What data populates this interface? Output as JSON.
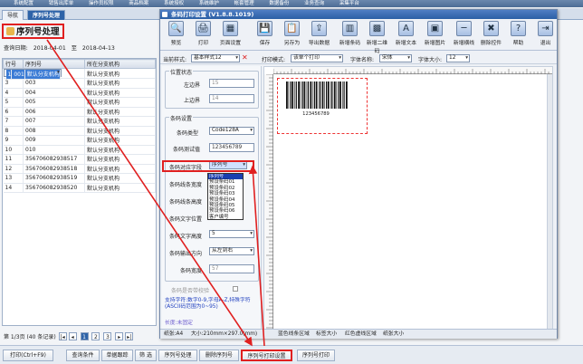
{
  "topbar": {
    "items": [
      "系统配置",
      "销售出库单",
      "操作员权限",
      "商品档案",
      "系统授权",
      "系统维护",
      "帐套管理",
      "数据备份",
      "业务查询",
      "采集平台"
    ]
  },
  "tabs": [
    {
      "label": "导航"
    },
    {
      "label": "序列号处理"
    }
  ],
  "page": {
    "title": "序列号处理"
  },
  "query": {
    "label": "查询日期:",
    "from": "2018-04-01",
    "to_label": "至",
    "to": "2018-04-13"
  },
  "grid": {
    "columns": [
      "行号",
      "序列号",
      "所在分支机构"
    ],
    "rows": [
      [
        "1",
        "001",
        "默认分支机构"
      ],
      [
        "2",
        "002",
        "默认分支机构"
      ],
      [
        "3",
        "003",
        "默认分支机构"
      ],
      [
        "4",
        "004",
        "默认分支机构"
      ],
      [
        "5",
        "005",
        "默认分支机构"
      ],
      [
        "6",
        "006",
        "默认分支机构"
      ],
      [
        "7",
        "007",
        "默认分支机构"
      ],
      [
        "8",
        "008",
        "默认分支机构"
      ],
      [
        "9",
        "009",
        "默认分支机构"
      ],
      [
        "10",
        "010",
        "默认分支机构"
      ],
      [
        "11",
        "356706082938517",
        "默认分支机构"
      ],
      [
        "12",
        "356706082938518",
        "默认分支机构"
      ],
      [
        "13",
        "356706082938519",
        "默认分支机构"
      ],
      [
        "14",
        "356706082938520",
        "默认分支机构"
      ]
    ]
  },
  "pager": {
    "summary": "第 1/3页 (40 条记录)",
    "pages": [
      "1",
      "2",
      "3"
    ]
  },
  "bottom_buttons": [
    "打印(Ctrl+F9)",
    "查询条件",
    "单据跟踪",
    "筛 选",
    "序列号处理",
    "删除序列号",
    "序列号打印设置",
    "序列号打印"
  ],
  "dialog": {
    "title": "条码打印设置 (V1.8.8.1019)",
    "toolbar": [
      "预览",
      "打印",
      "页面设置",
      "保存",
      "另存为",
      "导出数据",
      "新增条码",
      "新增二维码",
      "新增文本",
      "新增图片",
      "新增横线",
      "删除控件",
      "帮助",
      "退出"
    ],
    "toolbar_icons": [
      "preview-icon",
      "print-icon",
      "page-setup-icon",
      "save-icon",
      "save-as-icon",
      "export-icon",
      "barcode-icon",
      "qrcode-icon",
      "text-icon",
      "image-icon",
      "line-icon",
      "delete-icon",
      "help-icon",
      "exit-icon"
    ],
    "row2": {
      "template_label": "当前样式:",
      "template_value": "基本样式12",
      "print_mode_label": "打印模式:",
      "print_mode_value": "该单个打印",
      "font_label": "字体名称:",
      "font_value": "宋体",
      "size_label": "字体大小:",
      "size_value": "12"
    },
    "position": {
      "group": "位置状态",
      "left_label": "左边界",
      "left_value": "15",
      "top_label": "上边界",
      "top_value": "14"
    },
    "barcode": {
      "group": "条码设置",
      "type_label": "条码类型",
      "type_value": "Code128A",
      "test_label": "条码测试值",
      "test_value": "123456789",
      "field_label": "条码对应字段",
      "field_value": "序列号",
      "dropdown_options": [
        "序列号",
        "预设条码01",
        "预设条码02",
        "预设条码03",
        "预设条码04",
        "预设条码05",
        "预设条码06",
        "客户编号"
      ],
      "line_w_label": "条码线条宽度",
      "line_w_value": "",
      "line_h_label": "条码线条高度",
      "line_h_value": "",
      "font_pos_label": "条码文字位置",
      "font_pos_value": "",
      "text_size_label": "条码文字高度",
      "text_size_value": "5",
      "dir_label": "条码输出方向",
      "dir_value": "从左到右",
      "width_label": "条码宽度",
      "width_value": "57",
      "check_label": "条码是否带校验"
    },
    "hint": {
      "line1": "支持字符:数字0-9,字母A-Z,特殊字符(ASCII码范围为0~95)",
      "line2": "长度:未固定"
    },
    "barcode_preview": {
      "text": "123456789"
    },
    "status": {
      "paper": "纸张:A4",
      "size": "大小:210mm×297.0(mm)",
      "blue": "蓝色线条区域",
      "label": "标签大小",
      "red": "红色虚线区域",
      "paper2": "纸张大小"
    }
  }
}
